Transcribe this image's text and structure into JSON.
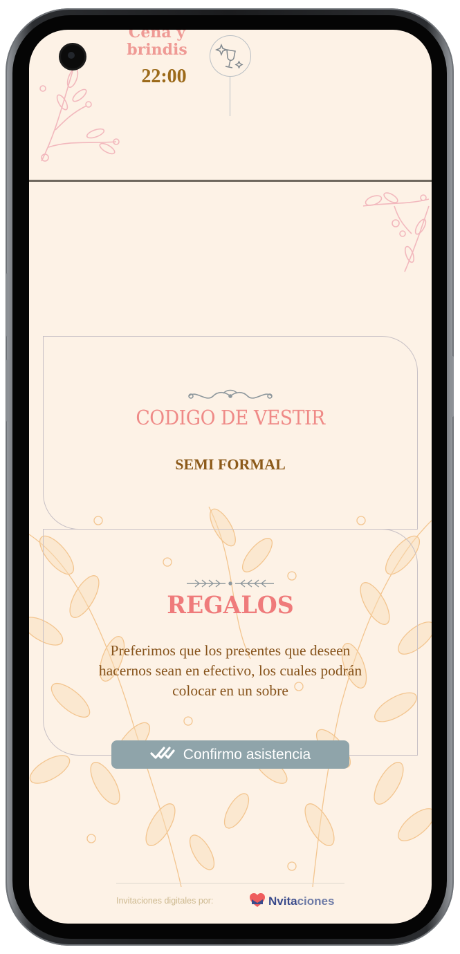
{
  "event": {
    "title": "Cena y brindis",
    "time": "22:00",
    "icon": "champagne-glass-icon"
  },
  "dress_code": {
    "title": "CODIGO DE VESTIR",
    "value": "SEMI FORMAL"
  },
  "gifts": {
    "title": "REGALOS",
    "text": "Preferimos que los presentes que deseen hacernos sean en efectivo, los cuales podrán colocar en un sobre"
  },
  "confirm_button": {
    "label": "Confirmo asistencia",
    "icon": "double-check-icon"
  },
  "footer": {
    "text": "Invitaciones digitales por:",
    "brand_prefix": "Nvita",
    "brand_suffix": "ciones",
    "brand_icon": "heart-envelope-logo"
  },
  "colors": {
    "background": "#fdf2e6",
    "accent_pink": "#ef8a87",
    "accent_brown": "#8c5a1a",
    "button": "#8fa4aa",
    "floral_pink": "#f2b8bd",
    "floral_orange": "#f3c58f"
  }
}
